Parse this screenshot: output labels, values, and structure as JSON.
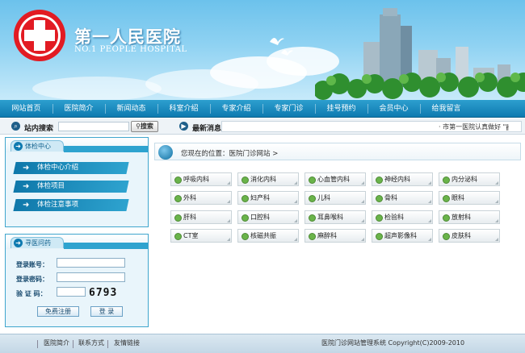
{
  "site": {
    "name_cn": "第一人民医院",
    "name_en": "NO.1 PEOPLE HOSPITAL"
  },
  "nav": [
    "网站首页",
    "医院简介",
    "新闻动态",
    "科室介绍",
    "专家介绍",
    "专家门诊",
    "挂号预约",
    "会员中心",
    "给我留言"
  ],
  "search": {
    "label": "站内搜索",
    "button": "搜索",
    "news_label": "最新消息",
    "news_text": "· 市第一医院认真做好 \"∦"
  },
  "checkup": {
    "title": "体检中心",
    "items": [
      "体检中心介绍",
      "体检项目",
      "体检注意事项"
    ]
  },
  "login": {
    "title": "寻医问药",
    "account_label": "登录账号：",
    "password_label": "登录密码：",
    "captcha_label": "验 证 码：",
    "captcha": "6793",
    "register": "免费注册",
    "login": "登 录"
  },
  "breadcrumb": "您现在的位置：医院门诊网站 >",
  "departments": [
    [
      "呼吸内科",
      "消化内科",
      "心血管内科",
      "神经内科",
      "内分泌科"
    ],
    [
      "外科",
      "妇产科",
      "儿科",
      "骨科",
      "眼科"
    ],
    [
      "肝科",
      "口腔科",
      "耳鼻喉科",
      "检验科",
      "放射科"
    ],
    [
      "CT室",
      "核磁共振",
      "麻醉科",
      "超声影像科",
      "皮肤科"
    ]
  ],
  "footer": {
    "links": [
      "医院简介",
      "联系方式",
      "友情链接"
    ],
    "copyright": "医院门诊网站管理系统 Copyright(C)2009-2010"
  },
  "colors": {
    "nav": "#0e7ab0",
    "accent": "#2ea3cf",
    "logo_red": "#e21b23"
  }
}
